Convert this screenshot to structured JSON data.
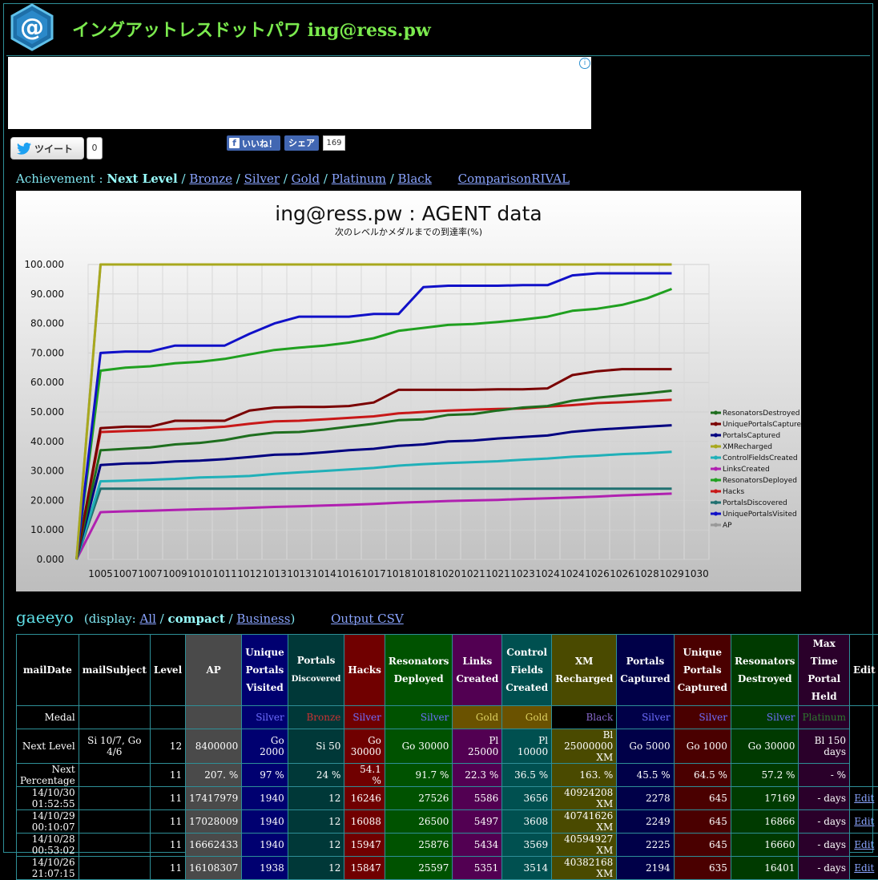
{
  "header": {
    "title_kana": "イングアットレスドットパワ",
    "title_domain": "ing@ress.pw",
    "logo_glyph": "@"
  },
  "social": {
    "tweet_label": "ツイート",
    "tweet_count": "0",
    "like_label": "いいね！",
    "share_label": "シェア",
    "share_count": "169"
  },
  "achievement_nav": {
    "prefix": "Achievement : ",
    "current": "Next Level",
    "links": [
      "Bronze",
      "Silver",
      "Gold",
      "Platinum",
      "Black"
    ],
    "rival": "ComparisonRIVAL"
  },
  "chart_data": {
    "type": "line",
    "title": "ing@ress.pw : AGENT data",
    "subtitle": "次のレベルかメダルまでの到達率(%)",
    "xlabel": "",
    "ylabel": "",
    "ylim": [
      0,
      100
    ],
    "grid": true,
    "legend": "right",
    "categories": [
      "1005",
      "1007",
      "1007",
      "1009",
      "1010",
      "1011",
      "1012",
      "1013",
      "1013",
      "1014",
      "1016",
      "1017",
      "1018",
      "1018",
      "1020",
      "1021",
      "1021",
      "1023",
      "1024",
      "1024",
      "1026",
      "1026",
      "1028",
      "1029",
      "1030"
    ],
    "series": [
      {
        "name": "ResonatorsDestroyed",
        "color": "#1e6e1e",
        "values": [
          0,
          37,
          37.5,
          38,
          39,
          39.5,
          40.5,
          42,
          43,
          43.2,
          44,
          45,
          46,
          47.2,
          47.5,
          49,
          49.3,
          50.5,
          51.5,
          52,
          53.8,
          54.8,
          55.6,
          56.3,
          57.2
        ]
      },
      {
        "name": "UniquePortalsCaptured",
        "color": "#7a0000",
        "values": [
          0,
          44.5,
          45,
          45,
          47,
          47,
          47,
          50.5,
          51.5,
          51.7,
          51.7,
          52,
          53.2,
          57.5,
          57.5,
          57.5,
          57.5,
          57.7,
          57.7,
          58,
          62.5,
          63.8,
          64.5,
          64.5,
          64.5
        ]
      },
      {
        "name": "PortalsCaptured",
        "color": "#000080",
        "values": [
          0,
          32,
          32.5,
          32.7,
          33.2,
          33.5,
          34,
          34.7,
          35.5,
          35.7,
          36.3,
          37,
          37.5,
          38.5,
          39,
          40,
          40.3,
          41,
          41.5,
          42,
          43.3,
          44,
          44.5,
          45,
          45.5
        ]
      },
      {
        "name": "XMRecharged",
        "color": "#a8a81e",
        "values": [
          0,
          100,
          100,
          100,
          100,
          100,
          100,
          100,
          100,
          100,
          100,
          100,
          100,
          100,
          100,
          100,
          100,
          100,
          100,
          100,
          100,
          100,
          100,
          100,
          100
        ]
      },
      {
        "name": "ControlFieldsCreated",
        "color": "#20b0b8",
        "values": [
          0,
          26.5,
          26.7,
          27,
          27.3,
          27.8,
          28,
          28.3,
          29,
          29.5,
          30,
          30.5,
          31,
          31.8,
          32.3,
          32.7,
          33,
          33.3,
          33.8,
          34.2,
          34.8,
          35.2,
          35.7,
          36,
          36.5
        ]
      },
      {
        "name": "LinksCreated",
        "color": "#b020b0",
        "values": [
          0,
          16,
          16.3,
          16.5,
          16.8,
          17,
          17.2,
          17.5,
          17.8,
          18,
          18.3,
          18.5,
          18.8,
          19.2,
          19.5,
          19.8,
          20,
          20.2,
          20.5,
          20.7,
          21,
          21.3,
          21.7,
          22,
          22.3
        ]
      },
      {
        "name": "ResonatorsDeployed",
        "color": "#20a020",
        "values": [
          0,
          64,
          65,
          65.5,
          66.5,
          67,
          68,
          69.5,
          71,
          71.8,
          72.5,
          73.5,
          75,
          77.5,
          78.5,
          79.5,
          79.8,
          80.5,
          81.3,
          82.3,
          84.3,
          85,
          86.3,
          88.5,
          91.7
        ]
      },
      {
        "name": "Hacks",
        "color": "#c81818",
        "values": [
          0,
          43.2,
          43.5,
          43.8,
          44.2,
          44.5,
          45,
          46,
          46.8,
          47,
          47.5,
          48,
          48.5,
          49.5,
          50,
          50.5,
          50.8,
          51,
          51.2,
          51.8,
          52.3,
          53,
          53.3,
          53.7,
          54.1
        ]
      },
      {
        "name": "PortalsDiscovered",
        "color": "#207070",
        "values": [
          0,
          24,
          24,
          24,
          24,
          24,
          24,
          24,
          24,
          24,
          24,
          24,
          24,
          24,
          24,
          24,
          24,
          24,
          24,
          24,
          24,
          24,
          24,
          24,
          24
        ]
      },
      {
        "name": "UniquePortalsVisited",
        "color": "#1010c8",
        "values": [
          0,
          70,
          70.5,
          70.5,
          72.5,
          72.5,
          72.5,
          76.5,
          80,
          82.3,
          82.3,
          82.3,
          83.2,
          83.2,
          92.3,
          92.8,
          92.8,
          92.8,
          93,
          93,
          96.3,
          97,
          97,
          97,
          97
        ]
      },
      {
        "name": "AP",
        "color": "#999999",
        "values": [
          0,
          100,
          100,
          100,
          100,
          100,
          100,
          100,
          100,
          100,
          100,
          100,
          100,
          100,
          100,
          100,
          100,
          100,
          100,
          100,
          100,
          100,
          100,
          100,
          100
        ]
      }
    ]
  },
  "userbar": {
    "name": "gaeeyo",
    "display_prefix": "(display: ",
    "display_all": "All",
    "display_compact": "compact",
    "display_business": "Business",
    "display_suffix": ")",
    "csv": "Output CSV"
  },
  "table": {
    "headers": {
      "mailDate": "mailDate",
      "mailSubject": "mailSubject",
      "level": "Level",
      "ap": "AP",
      "upv": [
        "Unique",
        "Portals",
        "Visited"
      ],
      "pd": [
        "Portals",
        "Discovered"
      ],
      "hacks": "Hacks",
      "rd": [
        "Resonators",
        "Deployed"
      ],
      "lc": [
        "Links",
        "Created"
      ],
      "cf": [
        "Control",
        "Fields",
        "Created"
      ],
      "xm": [
        "XM",
        "Recharged"
      ],
      "pc": [
        "Portals",
        "Captured"
      ],
      "upc": [
        "Unique",
        "Portals",
        "Captured"
      ],
      "rds": [
        "Resonators",
        "Destroyed"
      ],
      "mt": [
        "Max Time",
        "Portal",
        "Held"
      ],
      "edit": "Edit"
    },
    "medal": {
      "label": "Medal",
      "upv": "Silver",
      "pd": "Bronze",
      "hacks": "Silver",
      "rd": "Silver",
      "lc": "Gold",
      "cf": "Gold",
      "xm": "Black",
      "pc": "Silver",
      "upc": "Silver",
      "rds": "Silver",
      "mt": "Platinum"
    },
    "next_level": {
      "label": "Next Level",
      "subject": "Si 10/7, Go 4/6",
      "level": "12",
      "ap": "8400000",
      "upv": "Go 2000",
      "pd": "Si 50",
      "hacks": "Go 30000",
      "rd": "Go 30000",
      "lc": "Pl 25000",
      "cf": "Pl 10000",
      "xm": "Bl 25000000 XM",
      "pc": "Go 5000",
      "upc": "Go 1000",
      "rds": "Go 30000",
      "mt": "Bl 150 days"
    },
    "next_pct": {
      "label": "Next Percentage",
      "level": "11",
      "ap": "207. %",
      "upv": "97 %",
      "pd": "24 %",
      "hacks": "54.1 %",
      "rd": "91.7 %",
      "lc": "22.3 %",
      "cf": "36.5 %",
      "xm": "163. %",
      "pc": "45.5 %",
      "upc": "64.5 %",
      "rds": "57.2 %",
      "mt": "- %"
    },
    "rows": [
      {
        "date": "14/10/30 01:52:55",
        "level": "11",
        "ap": "17417979",
        "upv": "1940",
        "pd": "12",
        "hacks": "16246",
        "rd": "27526",
        "lc": "5586",
        "cf": "3656",
        "xm": "40924208 XM",
        "pc": "2278",
        "upc": "645",
        "rds": "17169",
        "mt": "- days",
        "edit": "Edit"
      },
      {
        "date": "14/10/29 00:10:07",
        "level": "11",
        "ap": "17028009",
        "upv": "1940",
        "pd": "12",
        "hacks": "16088",
        "rd": "26500",
        "lc": "5497",
        "cf": "3608",
        "xm": "40741626 XM",
        "pc": "2249",
        "upc": "645",
        "rds": "16866",
        "mt": "- days",
        "edit": "Edit"
      },
      {
        "date": "14/10/28 00:53:02",
        "level": "11",
        "ap": "16662433",
        "upv": "1940",
        "pd": "12",
        "hacks": "15947",
        "rd": "25876",
        "lc": "5434",
        "cf": "3569",
        "xm": "40594927 XM",
        "pc": "2225",
        "upc": "645",
        "rds": "16660",
        "mt": "- days",
        "edit": "Edit"
      },
      {
        "date": "14/10/26 21:07:15",
        "level": "11",
        "ap": "16108307",
        "upv": "1938",
        "pd": "12",
        "hacks": "15847",
        "rd": "25597",
        "lc": "5351",
        "cf": "3514",
        "xm": "40382168 XM",
        "pc": "2194",
        "upc": "635",
        "rds": "16401",
        "mt": "- days",
        "edit": "Edit"
      }
    ]
  }
}
